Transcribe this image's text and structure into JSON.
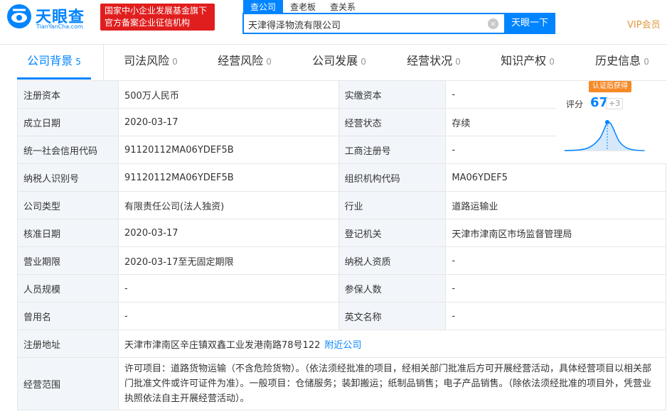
{
  "header": {
    "logo_text": "天眼查",
    "logo_sub": "TianYanCha.com",
    "gov_badge_line1": "国家中小企业发展基金旗下",
    "gov_badge_line2": "官方备案企业征信机构",
    "search_tabs": [
      "查公司",
      "查老板",
      "查关系"
    ],
    "search_value": "天津得泽物流有限公司",
    "search_button": "天眼一下",
    "vip": "VIP会员"
  },
  "tabs": [
    {
      "label": "公司背景",
      "count": "5"
    },
    {
      "label": "司法风险",
      "count": "0"
    },
    {
      "label": "经营风险",
      "count": "0"
    },
    {
      "label": "公司发展",
      "count": "0"
    },
    {
      "label": "经营状况",
      "count": "0"
    },
    {
      "label": "知识产权",
      "count": "0"
    },
    {
      "label": "历史信息",
      "count": "0"
    }
  ],
  "score": {
    "badge": "认证后获得",
    "label": "评分",
    "value": "67",
    "delta": "+3"
  },
  "rows": [
    {
      "l1": "注册资本",
      "v1": "500万人民币",
      "l2": "实缴资本",
      "v2": "-"
    },
    {
      "l1": "成立日期",
      "v1": "2020-03-17",
      "l2": "经营状态",
      "v2": "存续"
    },
    {
      "l1": "统一社会信用代码",
      "v1": "91120112MA06YDEF5B",
      "l2": "工商注册号",
      "v2": "-"
    },
    {
      "l1": "纳税人识别号",
      "v1": "91120112MA06YDEF5B",
      "l2": "组织机构代码",
      "v2": "MA06YDEF5"
    },
    {
      "l1": "公司类型",
      "v1": "有限责任公司(法人独资)",
      "l2": "行业",
      "v2": "道路运输业"
    },
    {
      "l1": "核准日期",
      "v1": "2020-03-17",
      "l2": "登记机关",
      "v2": "天津市津南区市场监督管理局"
    },
    {
      "l1": "营业期限",
      "v1": "2020-03-17至无固定期限",
      "l2": "纳税人资质",
      "v2": "-"
    },
    {
      "l1": "人员规模",
      "v1": "-",
      "l2": "参保人数",
      "v2": "-"
    },
    {
      "l1": "曾用名",
      "v1": "-",
      "l2": "英文名称",
      "v2": "-"
    }
  ],
  "address": {
    "label": "注册地址",
    "value": "天津市津南区辛庄镇双鑫工业发港南路78号122",
    "link": "附近公司"
  },
  "scope": {
    "label": "经营范围",
    "value": "许可项目：道路货物运输（不含危险货物）。（依法须经批准的项目，经相关部门批准后方可开展经营活动，具体经营项目以相关部门批准文件或许可证件为准）。一般项目：仓储服务；装卸搬运；纸制品销售；电子产品销售。（除依法须经批准的项目外，凭营业执照依法自主开展经营活动）。"
  },
  "colors": {
    "accent": "#0084ff",
    "badge_red": "#e11e1e",
    "vip": "#e09a3e"
  }
}
